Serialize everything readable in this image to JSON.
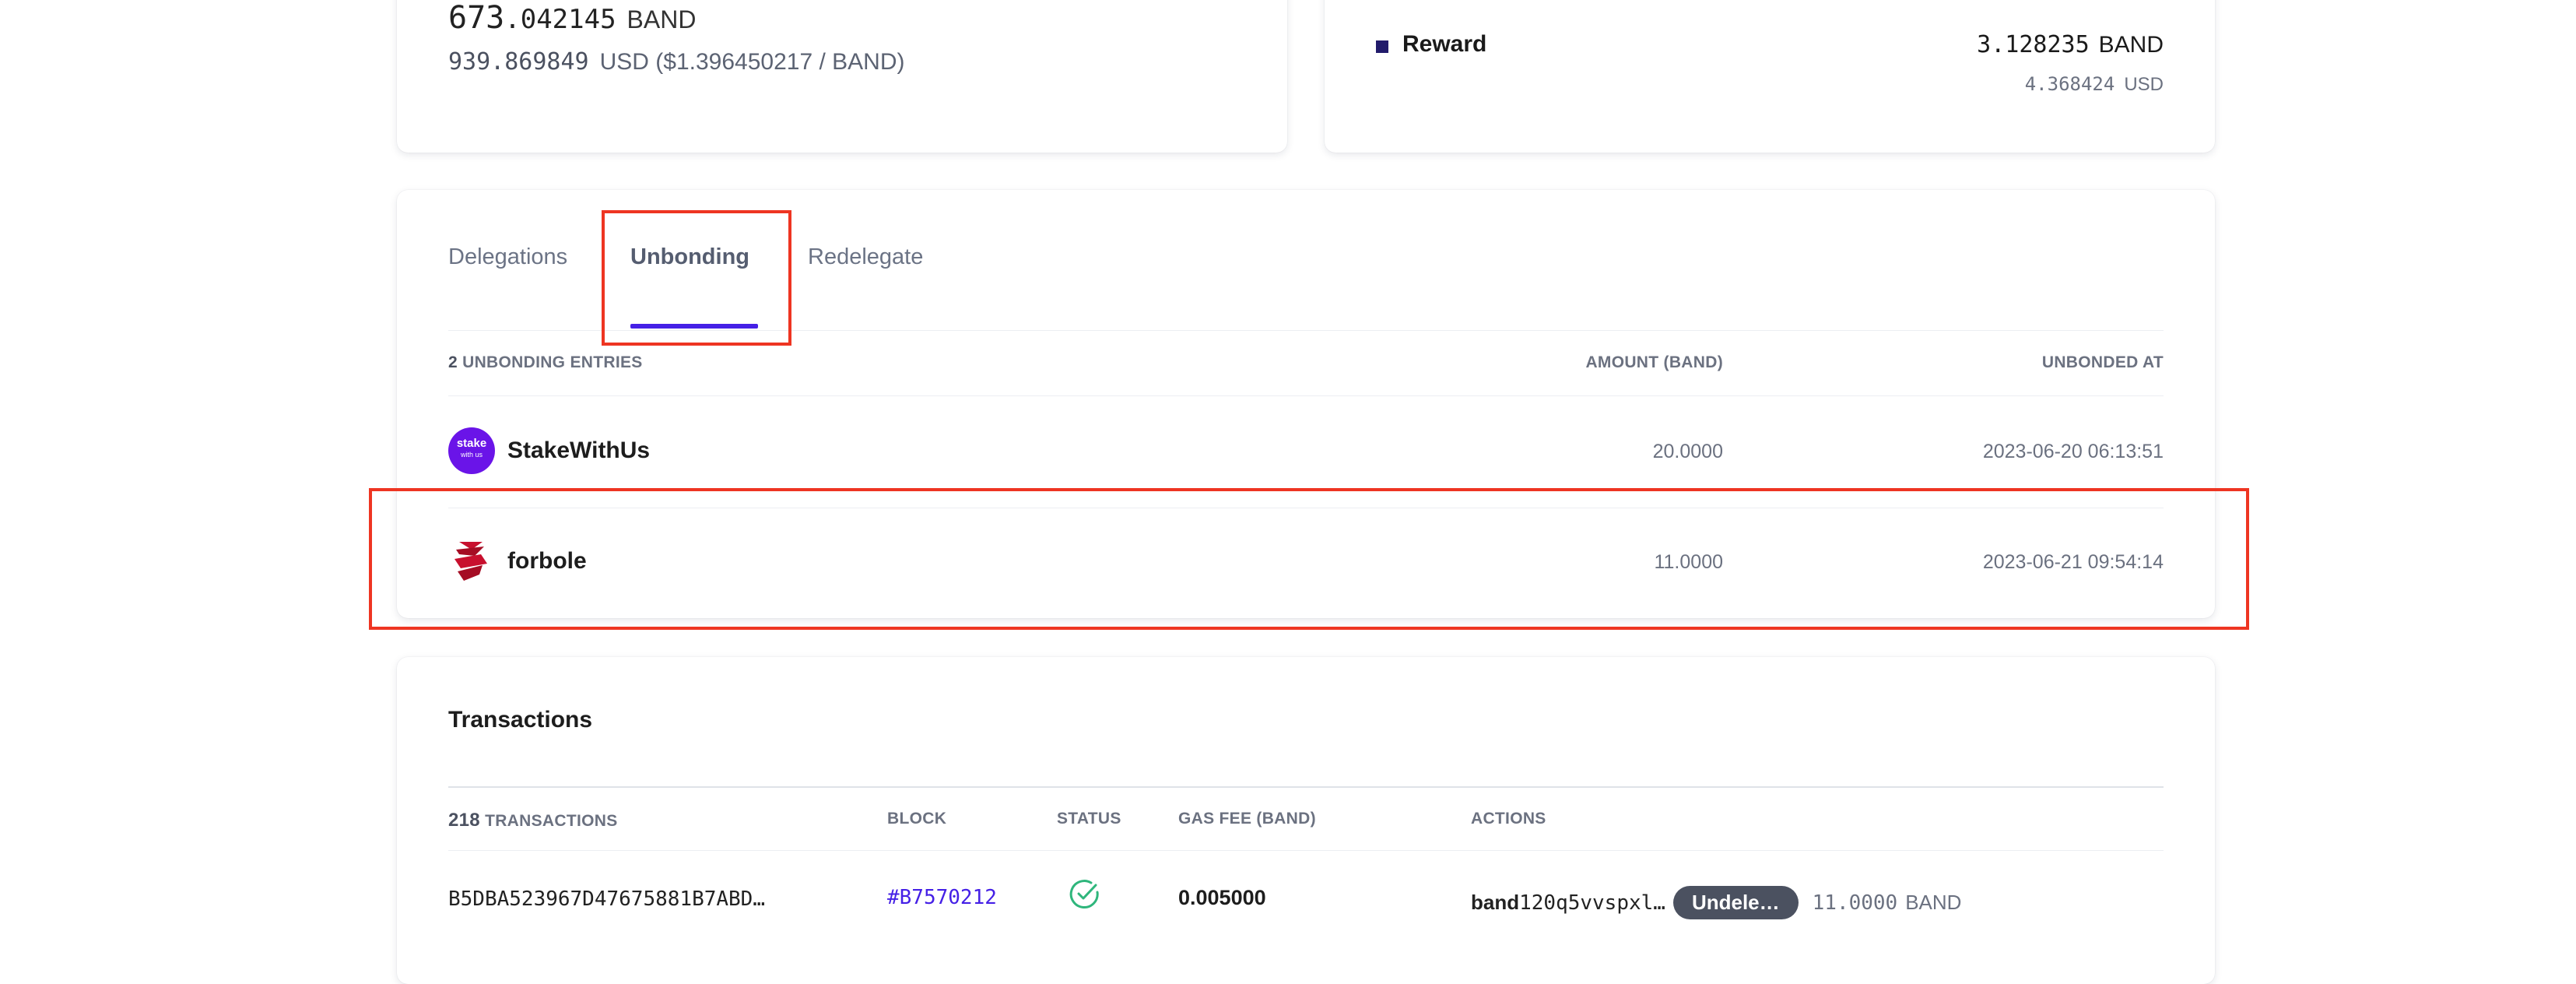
{
  "balance": {
    "amount_int": "673",
    "amount_dec": ".042145",
    "unit": "BAND",
    "usd_value": "939.869849",
    "usd_rest": "USD ($1.396450217 / BAND)"
  },
  "reward": {
    "label": "Reward",
    "amount": "3.128235",
    "unit": "BAND",
    "usd_value": "4.368424",
    "usd_unit": "USD",
    "square_color": "#221b6b"
  },
  "tabs": {
    "delegations": "Delegations",
    "unbonding": "Unbonding",
    "redelegate": "Redelegate",
    "active": "unbonding",
    "accent_color": "#4520e6"
  },
  "unbonding": {
    "count": "2",
    "entries_label": "UNBONDING ENTRIES",
    "col_amount": "AMOUNT (BAND)",
    "col_unbonded_at": "UNBONDED AT",
    "rows": [
      {
        "name": "StakeWithUs",
        "logo_top": "stake",
        "logo_bottom": "with us",
        "amount": "20.0000",
        "unbonded_at": "2023-06-20 06:13:51"
      },
      {
        "name": "forbole",
        "amount": "11.0000",
        "unbonded_at": "2023-06-21 09:54:14"
      }
    ]
  },
  "transactions": {
    "title": "Transactions",
    "count": "218",
    "count_label": "TRANSACTIONS",
    "col_block": "BLOCK",
    "col_status": "STATUS",
    "col_gas_fee": "GAS FEE (BAND)",
    "col_actions": "ACTIONS",
    "rows": [
      {
        "hash": "B5DBA523967D47675881B7ABD…",
        "block": "#B7570212",
        "status_icon": "success-check-icon",
        "gas_fee": "0.005000",
        "addr_prefix": "band",
        "addr_rest": "120q5vvspxl…",
        "action_badge": "Undele…",
        "action_amount": "11.0000",
        "action_unit": "BAND"
      }
    ]
  }
}
